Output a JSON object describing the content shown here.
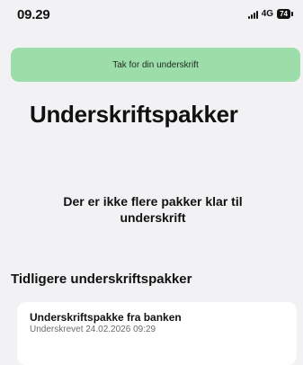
{
  "status_bar": {
    "time": "09.29",
    "network": "4G",
    "battery": "74"
  },
  "toast": {
    "message": "Tak for din underskrift",
    "color": "#9dddaa"
  },
  "page": {
    "title": "Underskriftspakker",
    "empty_message": "Der er ikke flere pakker klar til underskrift"
  },
  "previous": {
    "heading": "Tidligere underskriftspakker",
    "items": [
      {
        "title": "Underskriftspakke fra banken",
        "subtitle": "Underskrevet 24.02.2026 09:29"
      }
    ]
  },
  "icons": {
    "signal": "signal-strength-icon",
    "battery": "battery-icon"
  }
}
